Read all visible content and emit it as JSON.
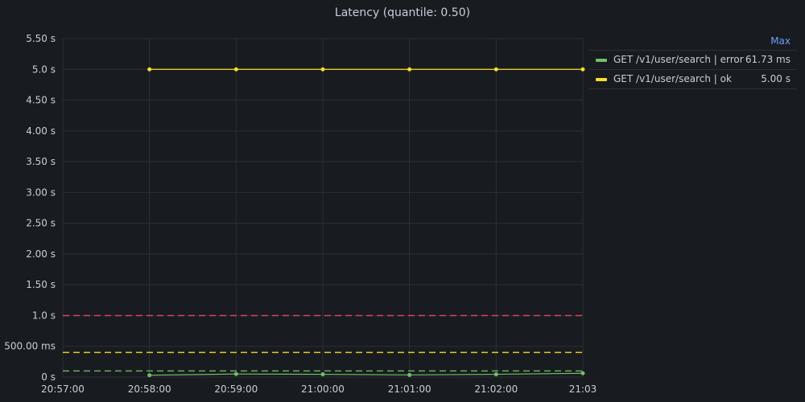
{
  "panel": {
    "title": "Latency (quantile: 0.50)"
  },
  "legend": {
    "max_header": "Max",
    "items": [
      {
        "label": "GET /v1/user/search | error",
        "max": "61.73 ms",
        "color": "#73bf69"
      },
      {
        "label": "GET /v1/user/search | ok",
        "max": "5.00 s",
        "color": "#fade2a"
      }
    ]
  },
  "chart_data": {
    "type": "line",
    "title": "Latency (quantile: 0.50)",
    "y_unit": "seconds",
    "ylim": [
      0,
      5.5
    ],
    "x_range": [
      "20:57:00",
      "21:03:00"
    ],
    "x_tick_labels": [
      "20:57:00",
      "20:58:00",
      "20:59:00",
      "21:00:00",
      "21:01:00",
      "21:02:00",
      "21:03"
    ],
    "y_tick_labels": [
      "0 s",
      "500.00 ms",
      "1.0 s",
      "1.50 s",
      "2.00 s",
      "2.50 s",
      "3.00 s",
      "3.50 s",
      "4.00 s",
      "4.50 s",
      "5.0 s",
      "5.50 s"
    ],
    "y_tick_values": [
      0,
      0.5,
      1.0,
      1.5,
      2.0,
      2.5,
      3.0,
      3.5,
      4.0,
      4.5,
      5.0,
      5.5
    ],
    "x": [
      "20:58:00",
      "20:59:00",
      "21:00:00",
      "21:01:00",
      "21:02:00",
      "21:03:00"
    ],
    "series": [
      {
        "name": "GET /v1/user/search | error",
        "color": "#73bf69",
        "values": [
          0.03,
          0.05,
          0.045,
          0.035,
          0.045,
          0.06173
        ]
      },
      {
        "name": "GET /v1/user/search | ok",
        "color": "#fade2a",
        "values": [
          5.0,
          5.0,
          5.0,
          5.0,
          5.0,
          5.0
        ]
      }
    ],
    "thresholds": [
      {
        "value": 1.0,
        "color": "#f2495c"
      },
      {
        "value": 0.4,
        "color": "#fade2a"
      },
      {
        "value": 0.1,
        "color": "#73bf69"
      }
    ],
    "grid": true,
    "legend_position": "right"
  }
}
